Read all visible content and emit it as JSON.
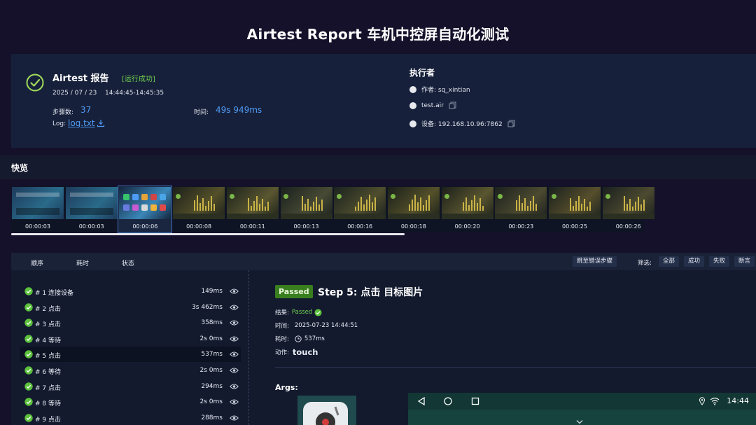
{
  "page": {
    "title": "Airtest Report 车机中控屏自动化测试"
  },
  "summary": {
    "title": "Airtest 报告",
    "status": "[运行成功]",
    "date": "2025 / 07 / 23",
    "time_range": "14:44:45-14:45:35",
    "steps_label": "步骤数:",
    "steps_value": "37",
    "duration_label": "时间:",
    "duration_value": "49s 949ms",
    "log_label": "Log:",
    "log_link": "log.txt",
    "executor_title": "执行者",
    "executor_rows": [
      "作者: sq_xintian",
      "test.air",
      "设备: 192.168.10.96:7862"
    ]
  },
  "quickview": {
    "title": "快览",
    "thumbnails": [
      "00:00:03",
      "00:00:03",
      "00:00:06",
      "00:00:08",
      "00:00:11",
      "00:00:13",
      "00:00:16",
      "00:00:18",
      "00:00:20",
      "00:00:23",
      "00:00:25",
      "00:00:26"
    ],
    "selected_index": 2
  },
  "steps_header": {
    "col_order": "顺序",
    "col_time": "耗时",
    "col_status": "状态",
    "jump_error": "跳至错误步骤",
    "filter_label": "筛选:",
    "filter_all": "全部",
    "filter_success": "成功",
    "filter_fail": "失败",
    "filter_assert": "断言"
  },
  "steps": [
    {
      "label": "# 1 连接设备",
      "duration": "149ms"
    },
    {
      "label": "# 2 点击",
      "duration": "3s 462ms"
    },
    {
      "label": "# 3 点击",
      "duration": "358ms"
    },
    {
      "label": "# 4 等待",
      "duration": "2s 0ms"
    },
    {
      "label": "# 5 点击",
      "duration": "537ms"
    },
    {
      "label": "# 6 等待",
      "duration": "2s 0ms"
    },
    {
      "label": "# 7 点击",
      "duration": "294ms"
    },
    {
      "label": "# 8 等待",
      "duration": "2s 0ms"
    },
    {
      "label": "# 9 点击",
      "duration": "288ms"
    }
  ],
  "active_step": 4,
  "detail": {
    "badge": "Passed",
    "title": "Step 5: 点击 目标图片",
    "result_label": "结果:",
    "result_value": "Passed",
    "time_label": "时间:",
    "time_value": "2025-07-23 14:44:51",
    "cost_label": "耗时:",
    "cost_value": "537ms",
    "action_label": "动作:",
    "action_value": "touch",
    "args_title": "Args:",
    "screen_time": "14:44"
  },
  "colors": {
    "accent_blue": "#4e9cf5",
    "success_green": "#6fcf4f",
    "badge_green": "#3a7f1f"
  }
}
